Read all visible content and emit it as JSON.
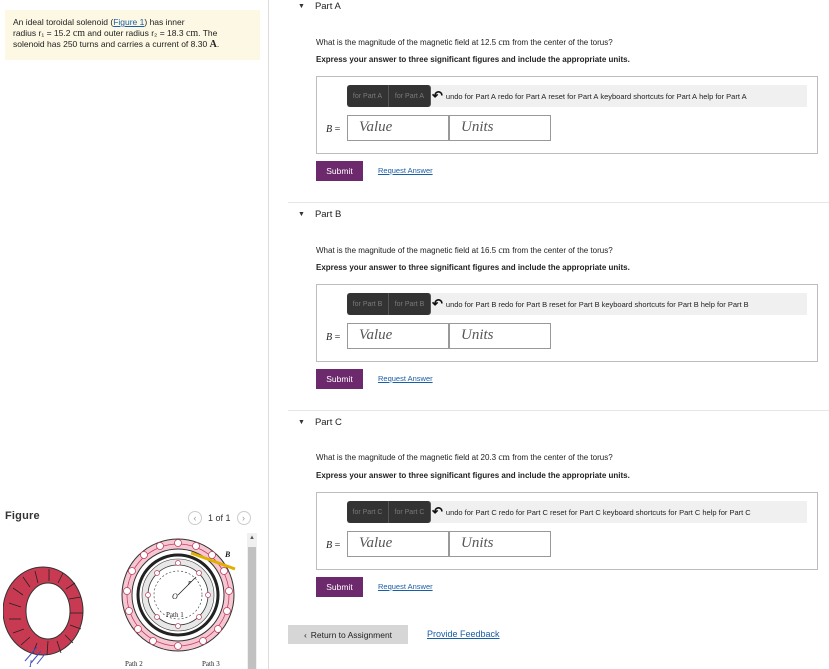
{
  "problem": {
    "line1_prefix": "An ideal toroidal solenoid (",
    "figure_link": "Figure 1",
    "line1_suffix": ") has inner",
    "r1_label": "radius r₁ = 15.2",
    "r1_unit": "cm",
    "r2_label": "and outer radius r₂ = 18.3",
    "r2_unit": "cm",
    "line2_end": ". The",
    "line3": "solenoid has 250 turns and carries a current of 8.30",
    "current_unit": "A",
    "line3_end": "."
  },
  "figure": {
    "label": "Figure",
    "pager_text": "1 of 1",
    "prev_icon": "‹",
    "next_icon": "›",
    "path1": "Path 1",
    "path2": "Path 2",
    "path3": "Path 3",
    "b_symbol": "B",
    "r_symbol": "r",
    "o_symbol": "O"
  },
  "parts": [
    {
      "header": "Part A",
      "question_prefix": "What is the magnitude of the magnetic field at 12.5",
      "question_unit": "cm",
      "question_suffix": "from the center of the torus?",
      "instruction": "Express your answer to three significant figures and include the appropriate units.",
      "toolbar": {
        "btn1": "for Part A",
        "btn2": "for Part A",
        "undo": "undo for Part A",
        "redo": "redo for Part A",
        "reset": "reset for Part A",
        "keyboard": "keyboard shortcuts for Part A",
        "help": "help for Part A"
      },
      "b_label": "B",
      "equals": "=",
      "value_placeholder": "Value",
      "units_placeholder": "Units",
      "submit": "Submit",
      "request": "Request Answer"
    },
    {
      "header": "Part B",
      "question_prefix": "What is the magnitude of the magnetic field at 16.5",
      "question_unit": "cm",
      "question_suffix": "from the center of the torus?",
      "instruction": "Express your answer to three significant figures and include the appropriate units.",
      "toolbar": {
        "btn1": "for Part B",
        "btn2": "for Part B",
        "undo": "undo for Part B",
        "redo": "redo for Part B",
        "reset": "reset for Part B",
        "keyboard": "keyboard shortcuts for Part B",
        "help": "help for Part B"
      },
      "b_label": "B",
      "equals": "=",
      "value_placeholder": "Value",
      "units_placeholder": "Units",
      "submit": "Submit",
      "request": "Request Answer"
    },
    {
      "header": "Part C",
      "question_prefix": "What is the magnitude of the magnetic field at 20.3",
      "question_unit": "cm",
      "question_suffix": "from the center of the torus?",
      "instruction": "Express your answer to three significant figures and include the appropriate units.",
      "toolbar": {
        "btn1": "for Part C",
        "btn2": "for Part C",
        "undo": "undo for Part C",
        "redo": "redo for Part C",
        "reset": "reset for Part C",
        "keyboard": "keyboard shortcuts for Part C",
        "help": "help for Part C"
      },
      "b_label": "B",
      "equals": "=",
      "value_placeholder": "Value",
      "units_placeholder": "Units",
      "submit": "Submit",
      "request": "Request Answer"
    }
  ],
  "footer": {
    "return_icon": "‹",
    "return_label": "Return to Assignment",
    "feedback": "Provide Feedback"
  },
  "colors": {
    "submit_bg": "#6c2a6c",
    "link": "#1a5ea8",
    "problem_bg": "#fcf8e4"
  }
}
